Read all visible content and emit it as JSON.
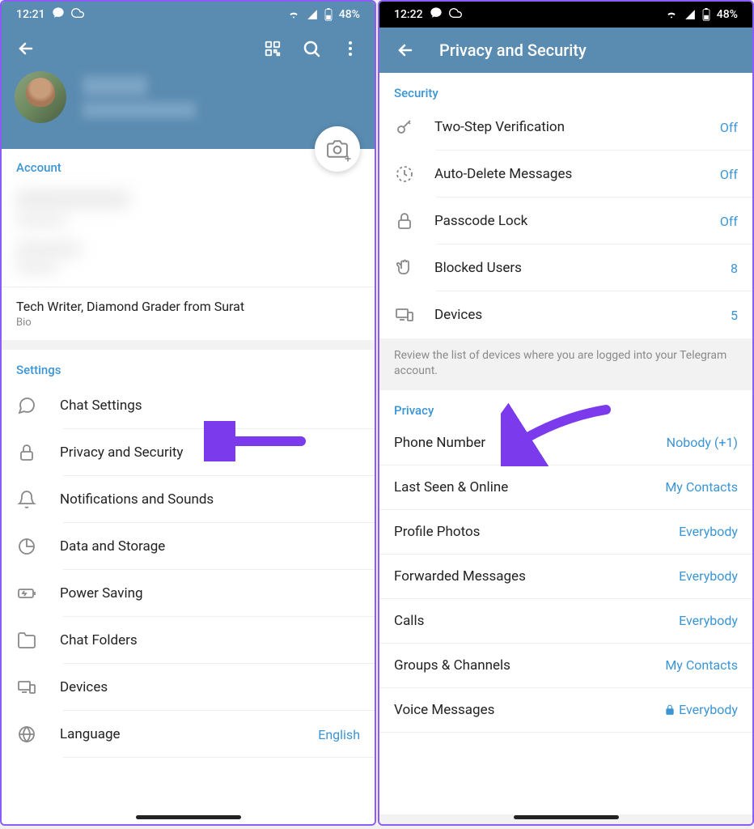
{
  "left": {
    "status": {
      "time": "12:21",
      "battery": "48%"
    },
    "account_header": "Account",
    "bio_text": "Tech Writer, Diamond Grader from Surat",
    "bio_label": "Bio",
    "settings_header": "Settings",
    "settings_items": [
      {
        "label": "Chat Settings"
      },
      {
        "label": "Privacy and Security"
      },
      {
        "label": "Notifications and Sounds"
      },
      {
        "label": "Data and Storage"
      },
      {
        "label": "Power Saving"
      },
      {
        "label": "Chat Folders"
      },
      {
        "label": "Devices"
      },
      {
        "label": "Language",
        "value": "English"
      }
    ]
  },
  "right": {
    "status": {
      "time": "12:22",
      "battery": "48%"
    },
    "title": "Privacy and Security",
    "security_header": "Security",
    "security_items": [
      {
        "label": "Two-Step Verification",
        "value": "Off"
      },
      {
        "label": "Auto-Delete Messages",
        "value": "Off"
      },
      {
        "label": "Passcode Lock",
        "value": "Off"
      },
      {
        "label": "Blocked Users",
        "value": "8"
      },
      {
        "label": "Devices",
        "value": "5"
      }
    ],
    "devices_note": "Review the list of devices where you are logged into your Telegram account.",
    "privacy_header": "Privacy",
    "privacy_items": [
      {
        "label": "Phone Number",
        "value": "Nobody (+1)"
      },
      {
        "label": "Last Seen & Online",
        "value": "My Contacts"
      },
      {
        "label": "Profile Photos",
        "value": "Everybody"
      },
      {
        "label": "Forwarded Messages",
        "value": "Everybody"
      },
      {
        "label": "Calls",
        "value": "Everybody"
      },
      {
        "label": "Groups & Channels",
        "value": "My Contacts"
      },
      {
        "label": "Voice Messages",
        "value": "Everybody",
        "locked": true
      }
    ]
  }
}
